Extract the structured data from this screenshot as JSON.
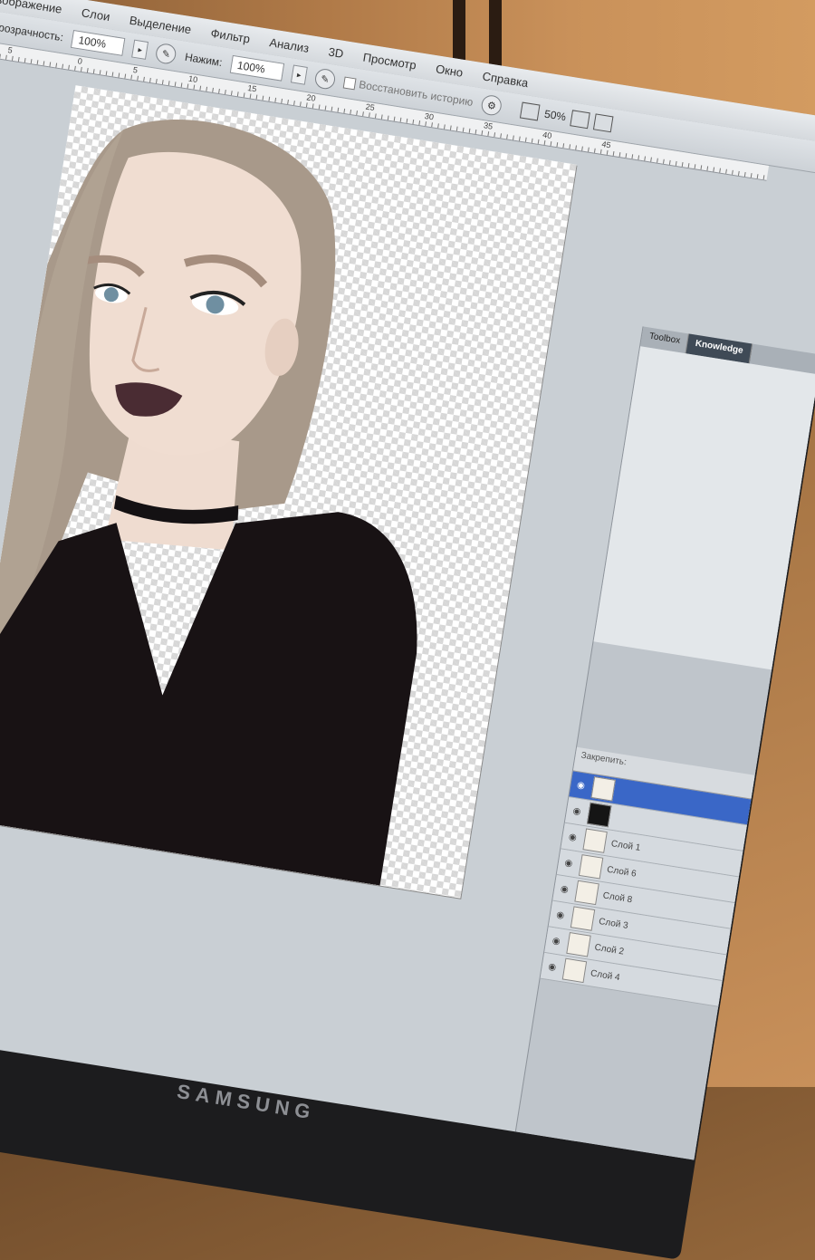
{
  "menu": [
    "Изображение",
    "Слои",
    "Выделение",
    "Фильтр",
    "Анализ",
    "3D",
    "Просмотр",
    "Окно",
    "Справка"
  ],
  "options": {
    "opacity_label": "Непрозрачность:",
    "opacity_value": "100%",
    "flow_label": "Нажим:",
    "flow_value": "100%",
    "history_label": "Восстановить историю"
  },
  "view": {
    "zoom": "50%"
  },
  "ruler_numbers": [
    "5",
    "0",
    "5",
    "10",
    "15",
    "20",
    "25",
    "30",
    "35",
    "40",
    "45"
  ],
  "panel": {
    "tabs": [
      "Toolbox",
      "Knowledge"
    ]
  },
  "layers": {
    "header": "Закрепить:",
    "items": [
      {
        "label": "",
        "selected": true,
        "dark": false
      },
      {
        "label": "",
        "selected": false,
        "dark": true
      },
      {
        "label": "Слой 1",
        "selected": false,
        "dark": false
      },
      {
        "label": "Слой 6",
        "selected": false,
        "dark": false
      },
      {
        "label": "Слой 8",
        "selected": false,
        "dark": false
      },
      {
        "label": "Слой 3",
        "selected": false,
        "dark": false
      },
      {
        "label": "Слой 2",
        "selected": false,
        "dark": false
      },
      {
        "label": "Слой 4",
        "selected": false,
        "dark": false
      }
    ]
  },
  "monitor_brand": "SAMSUNG"
}
